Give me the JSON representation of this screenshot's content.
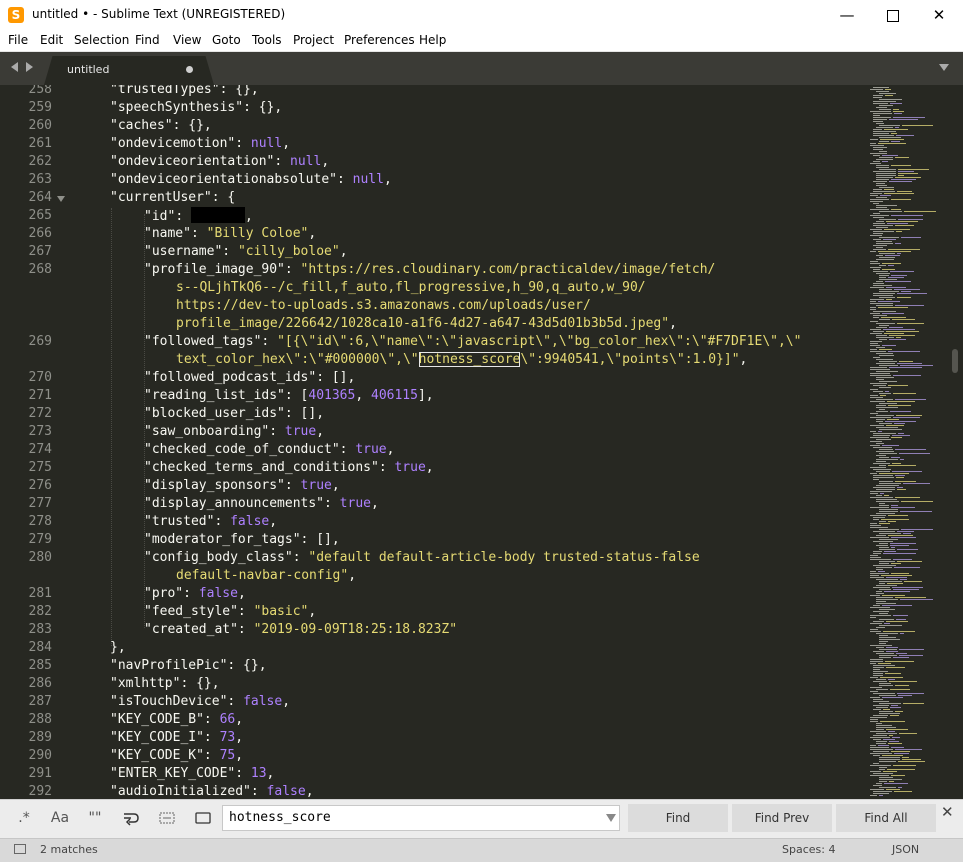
{
  "window": {
    "title": "untitled • - Sublime Text (UNREGISTERED)",
    "app_icon": "S",
    "minimize": "—",
    "close": "✕"
  },
  "menu": [
    "File",
    "Edit",
    "Selection",
    "Find",
    "View",
    "Goto",
    "Tools",
    "Project",
    "Preferences",
    "Help"
  ],
  "tab": {
    "label": "untitled"
  },
  "editor": {
    "language": "JSON",
    "line_numbers": [
      "258",
      "259",
      "260",
      "261",
      "262",
      "263",
      "264",
      "265",
      "266",
      "267",
      "268",
      "269",
      "270",
      "271",
      "272",
      "273",
      "274",
      "275",
      "276",
      "277",
      "278",
      "279",
      "280",
      "281",
      "282",
      "283",
      "284",
      "285",
      "286",
      "287",
      "288",
      "289",
      "290",
      "291",
      "292"
    ],
    "lines": [
      [
        [
          "k",
          "\"trustedTypes\""
        ],
        [
          "p",
          ": {},"
        ]
      ],
      [
        [
          "k",
          "\"speechSynthesis\""
        ],
        [
          "p",
          ": {},"
        ]
      ],
      [
        [
          "k",
          "\"caches\""
        ],
        [
          "p",
          ": {},"
        ]
      ],
      [
        [
          "k",
          "\"ondevicemotion\""
        ],
        [
          "p",
          ": "
        ],
        [
          "c",
          "null"
        ],
        [
          "p",
          ","
        ]
      ],
      [
        [
          "k",
          "\"ondeviceorientation\""
        ],
        [
          "p",
          ": "
        ],
        [
          "c",
          "null"
        ],
        [
          "p",
          ","
        ]
      ],
      [
        [
          "k",
          "\"ondeviceorientationabsolute\""
        ],
        [
          "p",
          ": "
        ],
        [
          "c",
          "null"
        ],
        [
          "p",
          ","
        ]
      ],
      [
        [
          "k",
          "\"currentUser\""
        ],
        [
          "p",
          ": {"
        ]
      ],
      [
        [
          "k",
          "\"id\""
        ],
        [
          "p",
          ": "
        ],
        [
          "r",
          ""
        ],
        [
          "p",
          ","
        ]
      ],
      [
        [
          "k",
          "\"name\""
        ],
        [
          "p",
          ": "
        ],
        [
          "s",
          "\"Billy Coloe\""
        ],
        [
          "p",
          ","
        ]
      ],
      [
        [
          "k",
          "\"username\""
        ],
        [
          "p",
          ": "
        ],
        [
          "s",
          "\"cilly_boloe\""
        ],
        [
          "p",
          ","
        ]
      ],
      [
        [
          "k",
          "\"profile_image_90\""
        ],
        [
          "p",
          ": "
        ],
        [
          "s",
          "\"https://res.cloudinary.com/practicaldev/image/fetch/"
        ]
      ],
      [
        [
          "s",
          "s--QLjhTkQ6--/c_fill,f_auto,fl_progressive,h_90,q_auto,w_90/"
        ]
      ],
      [
        [
          "s",
          "https://dev-to-uploads.s3.amazonaws.com/uploads/user/"
        ]
      ],
      [
        [
          "s",
          "profile_image/226642/1028ca10-a1f6-4d27-a647-43d5d01b3b5d.jpeg\""
        ],
        [
          "p",
          ","
        ]
      ],
      [
        [
          "k",
          "\"followed_tags\""
        ],
        [
          "p",
          ": "
        ],
        [
          "s",
          "\"[{\\\"id\\\":6,\\\"name\\\":\\\"javascript\\\",\\\"bg_color_hex\\\":\\\"#F7DF1E\\\",\\\""
        ]
      ],
      [
        [
          "s",
          "text_color_hex\\\":\\\"#000000\\\",\\\""
        ],
        [
          "h",
          "hotness_score"
        ],
        [
          "s",
          "\\\":9940541,\\\"points\\\":1.0}]\""
        ],
        [
          "p",
          ","
        ]
      ],
      [
        [
          "k",
          "\"followed_podcast_ids\""
        ],
        [
          "p",
          ": [],"
        ]
      ],
      [
        [
          "k",
          "\"reading_list_ids\""
        ],
        [
          "p",
          ": ["
        ],
        [
          "c",
          "401365"
        ],
        [
          "p",
          ", "
        ],
        [
          "c",
          "406115"
        ],
        [
          "p",
          "],"
        ]
      ],
      [
        [
          "k",
          "\"blocked_user_ids\""
        ],
        [
          "p",
          ": [],"
        ]
      ],
      [
        [
          "k",
          "\"saw_onboarding\""
        ],
        [
          "p",
          ": "
        ],
        [
          "c",
          "true"
        ],
        [
          "p",
          ","
        ]
      ],
      [
        [
          "k",
          "\"checked_code_of_conduct\""
        ],
        [
          "p",
          ": "
        ],
        [
          "c",
          "true"
        ],
        [
          "p",
          ","
        ]
      ],
      [
        [
          "k",
          "\"checked_terms_and_conditions\""
        ],
        [
          "p",
          ": "
        ],
        [
          "c",
          "true"
        ],
        [
          "p",
          ","
        ]
      ],
      [
        [
          "k",
          "\"display_sponsors\""
        ],
        [
          "p",
          ": "
        ],
        [
          "c",
          "true"
        ],
        [
          "p",
          ","
        ]
      ],
      [
        [
          "k",
          "\"display_announcements\""
        ],
        [
          "p",
          ": "
        ],
        [
          "c",
          "true"
        ],
        [
          "p",
          ","
        ]
      ],
      [
        [
          "k",
          "\"trusted\""
        ],
        [
          "p",
          ": "
        ],
        [
          "c",
          "false"
        ],
        [
          "p",
          ","
        ]
      ],
      [
        [
          "k",
          "\"moderator_for_tags\""
        ],
        [
          "p",
          ": [],"
        ]
      ],
      [
        [
          "k",
          "\"config_body_class\""
        ],
        [
          "p",
          ": "
        ],
        [
          "s",
          "\"default default-article-body trusted-status-false"
        ]
      ],
      [
        [
          "s",
          "default-navbar-config\""
        ],
        [
          "p",
          ","
        ]
      ],
      [
        [
          "k",
          "\"pro\""
        ],
        [
          "p",
          ": "
        ],
        [
          "c",
          "false"
        ],
        [
          "p",
          ","
        ]
      ],
      [
        [
          "k",
          "\"feed_style\""
        ],
        [
          "p",
          ": "
        ],
        [
          "s",
          "\"basic\""
        ],
        [
          "p",
          ","
        ]
      ],
      [
        [
          "k",
          "\"created_at\""
        ],
        [
          "p",
          ": "
        ],
        [
          "s",
          "\"2019-09-09T18:25:18.823Z\""
        ]
      ],
      [
        [
          "p",
          "},"
        ]
      ],
      [
        [
          "k",
          "\"navProfilePic\""
        ],
        [
          "p",
          ": {},"
        ]
      ],
      [
        [
          "k",
          "\"xmlhttp\""
        ],
        [
          "p",
          ": {},"
        ]
      ],
      [
        [
          "k",
          "\"isTouchDevice\""
        ],
        [
          "p",
          ": "
        ],
        [
          "c",
          "false"
        ],
        [
          "p",
          ","
        ]
      ],
      [
        [
          "k",
          "\"KEY_CODE_B\""
        ],
        [
          "p",
          ": "
        ],
        [
          "c",
          "66"
        ],
        [
          "p",
          ","
        ]
      ],
      [
        [
          "k",
          "\"KEY_CODE_I\""
        ],
        [
          "p",
          ": "
        ],
        [
          "c",
          "73"
        ],
        [
          "p",
          ","
        ]
      ],
      [
        [
          "k",
          "\"KEY_CODE_K\""
        ],
        [
          "p",
          ": "
        ],
        [
          "c",
          "75"
        ],
        [
          "p",
          ","
        ]
      ],
      [
        [
          "k",
          "\"ENTER_KEY_CODE\""
        ],
        [
          "p",
          ": "
        ],
        [
          "c",
          "13"
        ],
        [
          "p",
          ","
        ]
      ],
      [
        [
          "k",
          "\"audioInitialized\""
        ],
        [
          "p",
          ": "
        ],
        [
          "c",
          "false"
        ],
        [
          "p",
          ","
        ]
      ]
    ]
  },
  "find": {
    "options": {
      "regex": ".*",
      "case": "Aa",
      "whole_word": "\"\"",
      "wrap_icon": "wrap-icon",
      "in_selection_icon": "in-selection-icon",
      "highlight_icon": "highlight-icon"
    },
    "value": "hotness_score",
    "find_label": "Find",
    "find_prev_label": "Find Prev",
    "find_all_label": "Find All",
    "close": "✕"
  },
  "status": {
    "matches": "2 matches",
    "spaces": "Spaces: 4",
    "syntax": "JSON"
  },
  "colors": {
    "background": "#272822",
    "string": "#e6db74",
    "constant": "#ae81ff",
    "gutter": "#8f908a"
  }
}
